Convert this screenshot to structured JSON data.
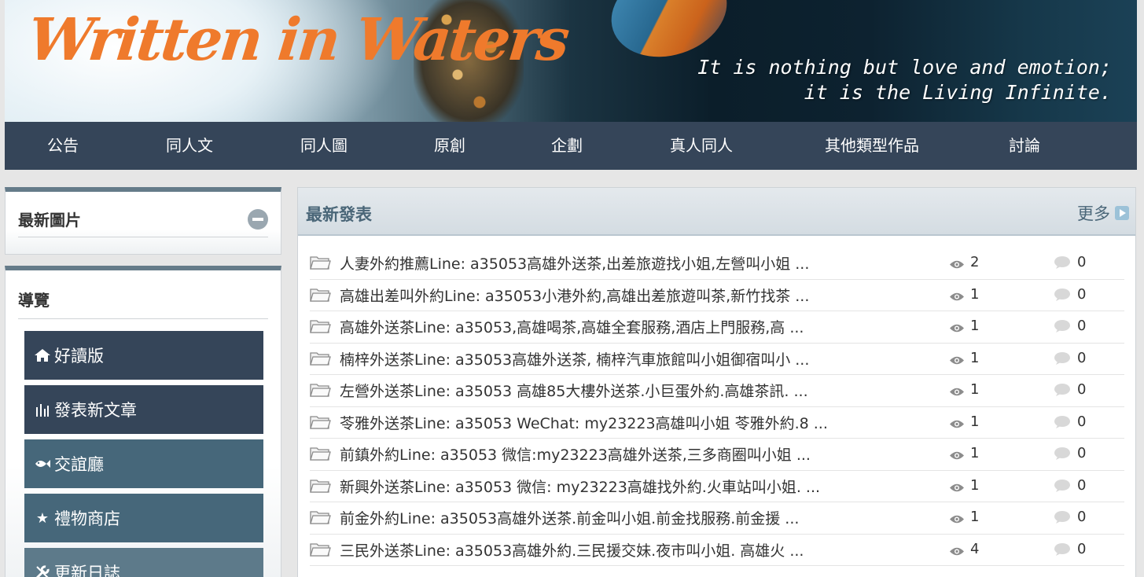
{
  "banner": {
    "logo_text": "Written in Waters",
    "tagline_line1": "It is nothing but love and emotion;",
    "tagline_line2": "it is the Living Infinite."
  },
  "nav": {
    "items": [
      {
        "label": "公告"
      },
      {
        "label": "同人文"
      },
      {
        "label": "同人圖"
      },
      {
        "label": "原創"
      },
      {
        "label": "企劃"
      },
      {
        "label": "真人同人"
      },
      {
        "label": "其他類型作品"
      },
      {
        "label": "討論"
      }
    ]
  },
  "sidebar": {
    "latest_images": {
      "title": "最新圖片"
    },
    "navigation": {
      "title": "導覽",
      "items": [
        {
          "label": "好讀版",
          "icon": "home-icon",
          "color": "#354559"
        },
        {
          "label": "發表新文章",
          "icon": "chart-icon",
          "color": "#354559"
        },
        {
          "label": "交誼廳",
          "icon": "fish-icon",
          "color": "#46677a"
        },
        {
          "label": "禮物商店",
          "icon": "star-icon",
          "color": "#46677a"
        },
        {
          "label": "更新日誌",
          "icon": "wrench-icon",
          "color": "#5d7a8a"
        }
      ]
    }
  },
  "main": {
    "title": "最新發表",
    "more_label": "更多",
    "posts": [
      {
        "title": "人妻外約推薦Line: a35053高雄外送茶,出差旅遊找小姐,左營叫小姐 ...",
        "views": "2",
        "comments": "0"
      },
      {
        "title": "高雄出差叫外約Line: a35053小港外約,高雄出差旅遊叫茶,新竹找茶 ...",
        "views": "1",
        "comments": "0"
      },
      {
        "title": "高雄外送茶Line: a35053,高雄喝茶,高雄全套服務,酒店上門服務,高 ...",
        "views": "1",
        "comments": "0"
      },
      {
        "title": "楠梓外送茶Line: a35053高雄外送茶, 楠梓汽車旅館叫小姐御宿叫小 ...",
        "views": "1",
        "comments": "0"
      },
      {
        "title": "左營外送茶Line: a35053 高雄85大樓外送茶.小巨蛋外約.高雄茶訊. ...",
        "views": "1",
        "comments": "0"
      },
      {
        "title": "苓雅外送茶Line: a35053 WeChat: my23223高雄叫小姐 苓雅外約.8 ...",
        "views": "1",
        "comments": "0"
      },
      {
        "title": "前鎮外約Line: a35053 微信:my23223高雄外送茶,三多商圈叫小姐 ...",
        "views": "1",
        "comments": "0"
      },
      {
        "title": "新興外送茶Line: a35053 微信: my23223高雄找外約.火車站叫小姐. ...",
        "views": "1",
        "comments": "0"
      },
      {
        "title": "前金外約Line: a35053高雄外送茶.前金叫小姐.前金找服務.前金援 ...",
        "views": "1",
        "comments": "0"
      },
      {
        "title": "三民外送茶Line: a35053高雄外約.三民援交妹.夜市叫小姐. 高雄火 ...",
        "views": "4",
        "comments": "0"
      }
    ]
  },
  "colors": {
    "nav_bg": "#354559",
    "logo_orange": "#ef7a2c",
    "panel_title": "#4a6678"
  }
}
